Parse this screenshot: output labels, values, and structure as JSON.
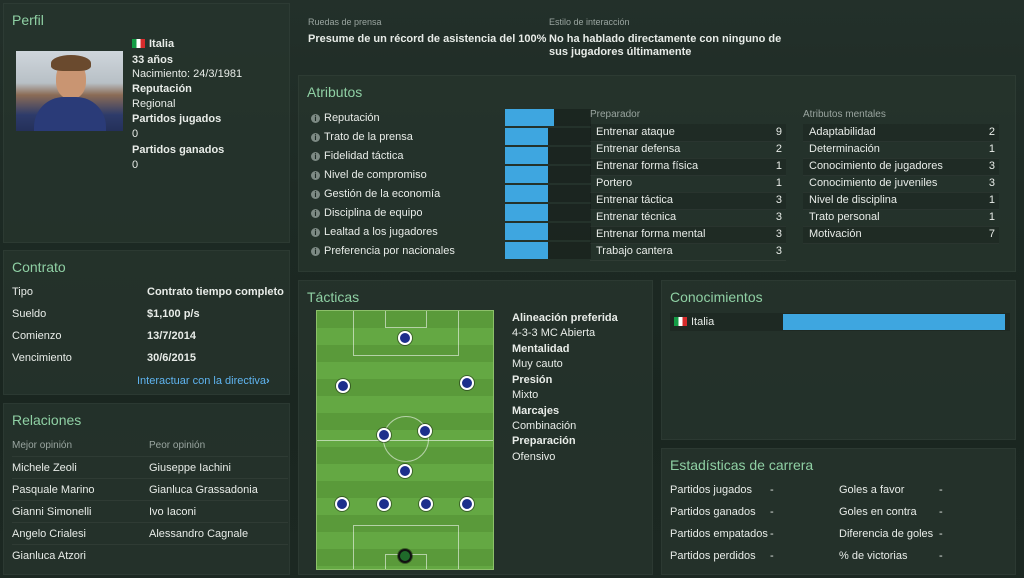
{
  "profile": {
    "title": "Perfil",
    "nationality": "Italia",
    "age": "33 años",
    "birth": "Nacimiento: 24/3/1981",
    "reputation_label": "Reputación",
    "reputation_value": "Regional",
    "games_label": "Partidos jugados",
    "games_value": "0",
    "wins_label": "Partidos ganados",
    "wins_value": "0"
  },
  "press": {
    "label": "Ruedas de prensa",
    "value": "Presume de un récord de asistencia del 100%",
    "style_label": "Estilo de interacción",
    "style_value_1": "No ha hablado directamente con ninguno de",
    "style_value_2": "sus jugadores últimamente"
  },
  "contract": {
    "title": "Contrato",
    "rows": [
      {
        "label": "Tipo",
        "value": "Contrato tiempo completo"
      },
      {
        "label": "Sueldo",
        "value": "$1,100 p/s"
      },
      {
        "label": "Comienzo",
        "value": "13/7/2014"
      },
      {
        "label": "Vencimiento",
        "value": "30/6/2015"
      }
    ],
    "link": "Interactuar con la directiva",
    "link_icon": "chevron-right-icon"
  },
  "relations": {
    "title": "Relaciones",
    "best_label": "Mejor opinión",
    "worst_label": "Peor opinión",
    "best": [
      "Michele Zeoli",
      "Pasquale Marino",
      "Gianni Simonelli",
      "Angelo Crialesi",
      "Gianluca Atzori"
    ],
    "worst": [
      "Giuseppe Iachini",
      "Gianluca Grassadonia",
      "Ivo Iaconi",
      "Alessandro Cagnale",
      ""
    ]
  },
  "attributes": {
    "title": "Atributos",
    "info_icon": "info-icon",
    "bars": [
      {
        "label": "Reputación",
        "level": 0.57
      },
      {
        "label": "Trato de la prensa",
        "level": 0.5
      },
      {
        "label": "Fidelidad táctica",
        "level": 0.5
      },
      {
        "label": "Nivel de compromiso",
        "level": 0.5
      },
      {
        "label": "Gestión de la economía",
        "level": 0.5
      },
      {
        "label": "Disciplina de equipo",
        "level": 0.5
      },
      {
        "label": "Lealtad a los jugadores",
        "level": 0.5
      },
      {
        "label": "Preferencia por nacionales",
        "level": 0.5
      }
    ],
    "coach_title": "Preparador",
    "coach": [
      {
        "label": "Entrenar ataque",
        "value": "9"
      },
      {
        "label": "Entrenar defensa",
        "value": "2"
      },
      {
        "label": "Entrenar forma física",
        "value": "1"
      },
      {
        "label": "Portero",
        "value": "1"
      },
      {
        "label": "Entrenar táctica",
        "value": "3"
      },
      {
        "label": "Entrenar técnica",
        "value": "3"
      },
      {
        "label": "Entrenar forma mental",
        "value": "3"
      },
      {
        "label": "Trabajo cantera",
        "value": "3"
      }
    ],
    "mental_title": "Atributos mentales",
    "mental": [
      {
        "label": "Adaptabilidad",
        "value": "2"
      },
      {
        "label": "Determinación",
        "value": "1"
      },
      {
        "label": "Conocimiento de jugadores",
        "value": "3"
      },
      {
        "label": "Conocimiento de juveniles",
        "value": "3"
      },
      {
        "label": "Nivel de disciplina",
        "value": "1"
      },
      {
        "label": "Trato personal",
        "value": "1"
      },
      {
        "label": "Motivación",
        "value": "7"
      }
    ]
  },
  "tactics": {
    "title": "Tácticas",
    "info": [
      {
        "label": "Alineación preferida",
        "value": "4-3-3 MC Abierta"
      },
      {
        "label": "Mentalidad",
        "value": "Muy cauto"
      },
      {
        "label": "Presión",
        "value": "Mixto"
      },
      {
        "label": "Marcajes",
        "value": "Combinación"
      },
      {
        "label": "Preparación",
        "value": "Ofensivo"
      }
    ]
  },
  "knowledge": {
    "title": "Conocimientos",
    "items": [
      {
        "label": "Italia",
        "level": 1.0
      }
    ]
  },
  "career": {
    "title": "Estadísticas de carrera",
    "left": [
      {
        "label": "Partidos jugados",
        "value": "-"
      },
      {
        "label": "Partidos ganados",
        "value": "-"
      },
      {
        "label": "Partidos empatados",
        "value": "-"
      },
      {
        "label": "Partidos perdidos",
        "value": "-"
      }
    ],
    "right": [
      {
        "label": "Goles a favor",
        "value": "-"
      },
      {
        "label": "Goles en contra",
        "value": "-"
      },
      {
        "label": "Diferencia de goles",
        "value": "-"
      },
      {
        "label": "% de victorias",
        "value": "-"
      }
    ]
  },
  "colors": {
    "accent": "#8fd0a4",
    "bar": "#3ea6e0",
    "link": "#5fb4f0"
  }
}
